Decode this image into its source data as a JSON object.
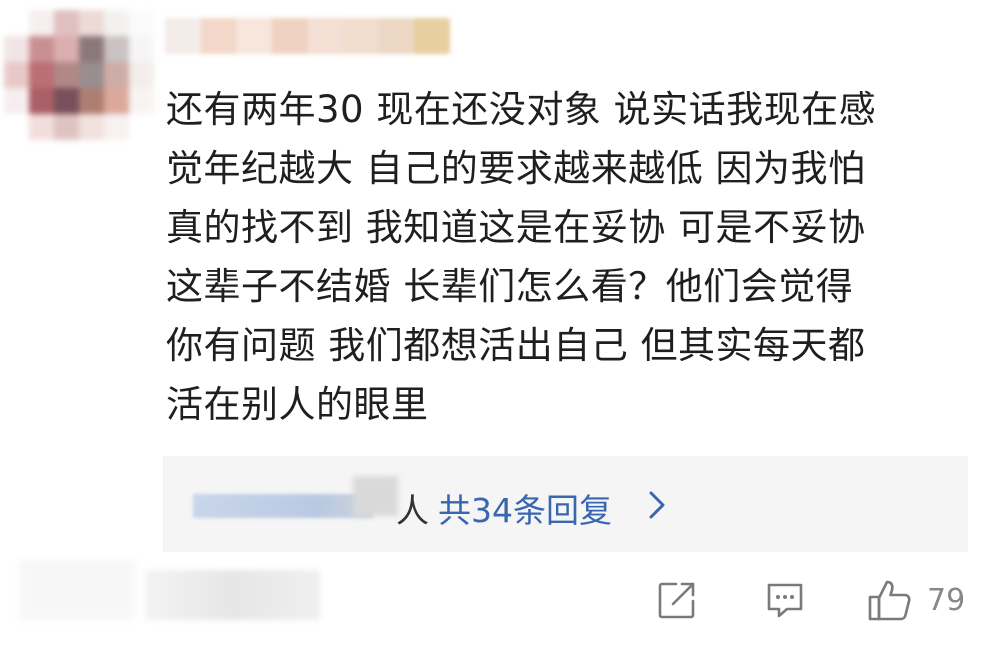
{
  "avatar": {
    "mosaic": [
      [
        "#ffffff",
        "#f6eeee",
        "#dcb9bb",
        "#ead7d3",
        "#f2f0ef",
        "#fbfbfb"
      ],
      [
        "#f0e2e3",
        "#c48487",
        "#d8a7a7",
        "#7f6a6d",
        "#c6bcbd",
        "#f5f5f5"
      ],
      [
        "#e6c3c3",
        "#b55f66",
        "#a87c78",
        "#8e8283",
        "#c9a49f",
        "#f2ece9"
      ],
      [
        "#f6eded",
        "#a34e57",
        "#6b3d4a",
        "#a67163",
        "#d99f92",
        "#f8f3f1"
      ],
      [
        "#ffffff",
        "#f1dada",
        "#dcbdba",
        "#efdfda",
        "#f7f0ee",
        "#ffffff"
      ]
    ]
  },
  "username": {
    "mosaic": [
      "#f4ece8",
      "#f3d7c9",
      "#f6e6dc",
      "#efd2c1",
      "#f3dfd4",
      "#f0ddcd",
      "#ecd8c4",
      "#e8cfa0"
    ]
  },
  "comment": {
    "lines": [
      "还有两年30 现在还没对象 说实话我现在感",
      "觉年纪越大 自己的要求越来越低 因为我怕",
      "真的找不到 我知道这是在妥协 可是不妥协",
      "这辈子不结婚 长辈们怎么看？他们会觉得",
      "你有问题 我们都想活出自己 但其实每天都",
      "活在别人的眼里"
    ]
  },
  "replies": {
    "ren_char": "人",
    "count_label": "共34条回复",
    "link_color": "#3a66b0"
  },
  "actions": {
    "share_icon": "share-icon",
    "comment_icon": "comment-icon",
    "like_icon": "thumbs-up-icon",
    "like_count": "79"
  }
}
